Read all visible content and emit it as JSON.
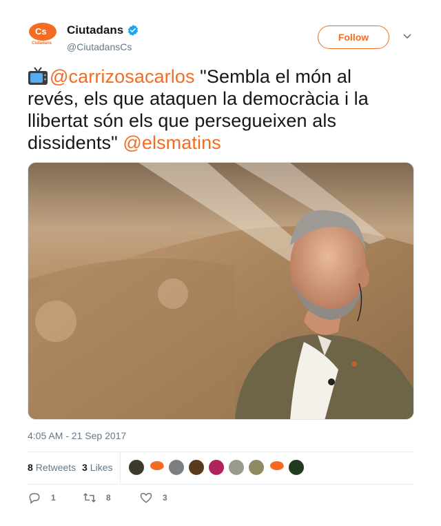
{
  "author": {
    "name": "Ciutadans",
    "handle": "@CiutadansCs",
    "avatar_text": "Cs",
    "avatar_sub": "Ciutadans",
    "verified": true
  },
  "follow_button": {
    "label": "Follow"
  },
  "tweet": {
    "emoji": "tv-icon",
    "mention1": "@carrizosacarlos",
    "quote": " \"Sembla el món al revés, els que ataquen la democràcia i la llibertat són els que persegueixen als dissidents\" ",
    "mention2": "@elsmatins"
  },
  "timestamp": "4:05 AM - 21 Sep 2017",
  "stats": {
    "retweets_count": "8",
    "retweets_label": "Retweets",
    "likes_count": "3",
    "likes_label": "Likes"
  },
  "liker_avatars": [
    {
      "name": "liker-avatar-1",
      "color": "#3b3a2c"
    },
    {
      "name": "liker-avatar-2",
      "color": "#f36c21",
      "logo": true
    },
    {
      "name": "liker-avatar-3",
      "color": "#7c7f82"
    },
    {
      "name": "liker-avatar-4",
      "color": "#5a3a1d"
    },
    {
      "name": "liker-avatar-5",
      "color": "#b0245c"
    },
    {
      "name": "liker-avatar-6",
      "color": "#9a9a8a"
    },
    {
      "name": "liker-avatar-7",
      "color": "#8f8a63"
    },
    {
      "name": "liker-avatar-8",
      "color": "#f36c21",
      "logo": true
    },
    {
      "name": "liker-avatar-9",
      "color": "#1f3a1e"
    }
  ],
  "actions": {
    "replies": "1",
    "retweets": "8",
    "likes": "3"
  },
  "colors": {
    "accent": "#f36c21",
    "verified": "#1da1f2",
    "secondary_text": "#657786"
  }
}
